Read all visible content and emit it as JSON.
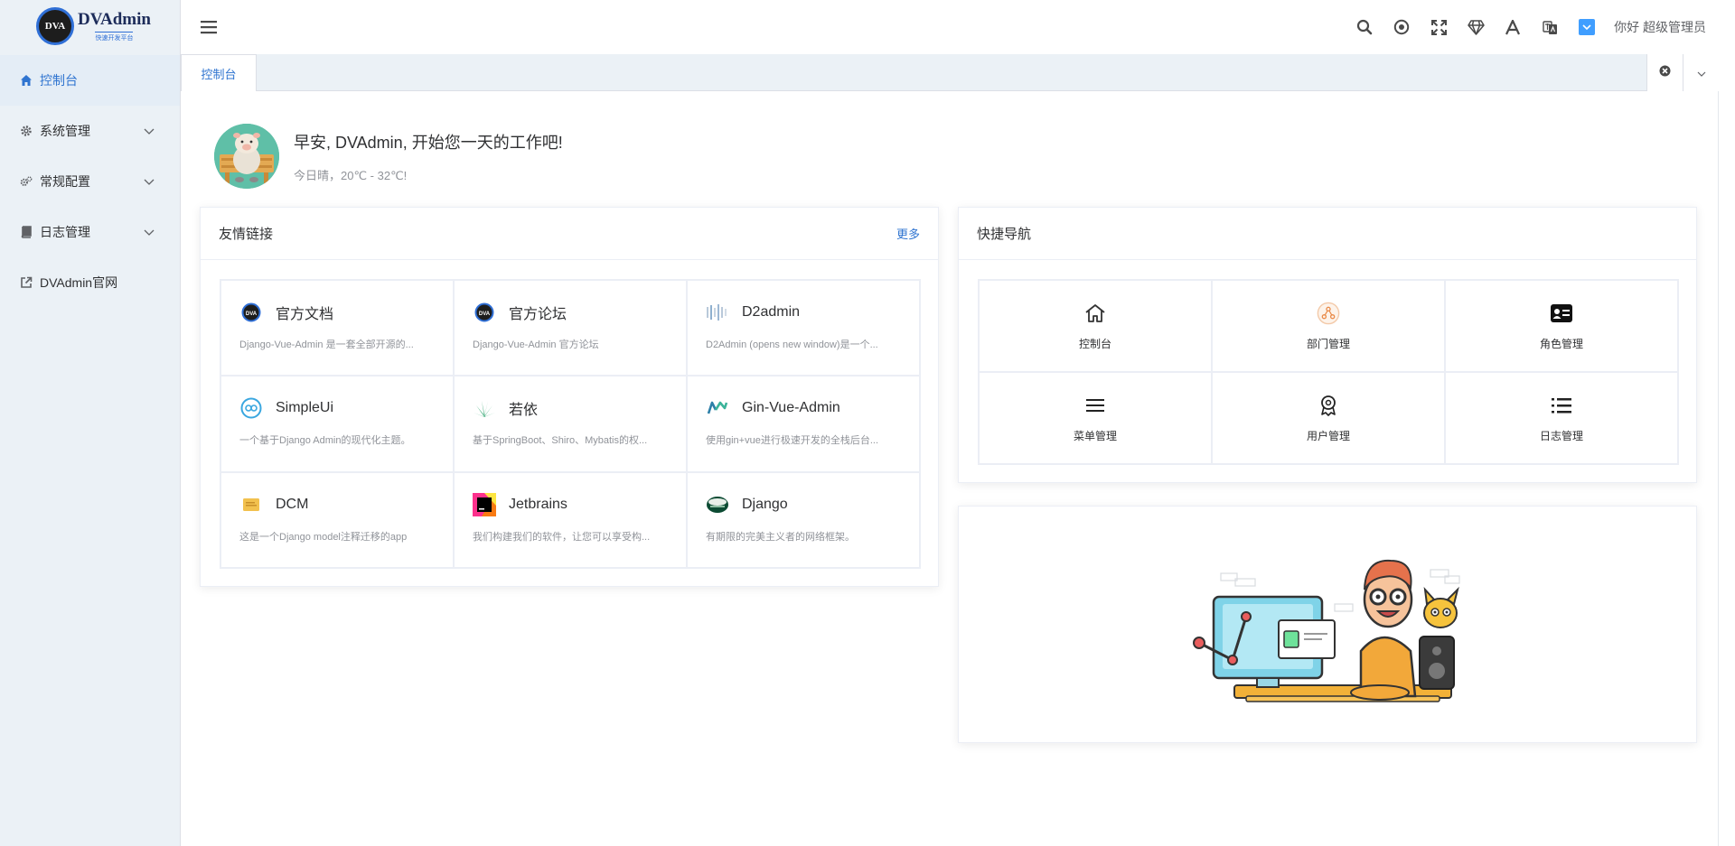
{
  "app": {
    "logo_mark": "DVA",
    "logo_title": "DVAdmin",
    "logo_subtitle": "快速开发平台"
  },
  "sidebar": {
    "items": [
      {
        "label": "控制台",
        "icon": "home-icon",
        "active": true
      },
      {
        "label": "系统管理",
        "icon": "gear-icon",
        "expandable": true
      },
      {
        "label": "常规配置",
        "icon": "gears-icon",
        "expandable": true
      },
      {
        "label": "日志管理",
        "icon": "book-icon",
        "expandable": true
      },
      {
        "label": "DVAdmin官网",
        "icon": "external-link-icon"
      }
    ]
  },
  "header": {
    "user_greeting": "你好 超级管理员",
    "tools": [
      "search-icon",
      "record-icon",
      "fullscreen-icon",
      "diamond-icon",
      "font-size-icon",
      "translate-icon",
      "theme-color-icon"
    ]
  },
  "tabs": {
    "items": [
      {
        "label": "控制台",
        "active": true
      }
    ]
  },
  "welcome": {
    "title": "早安, DVAdmin, 开始您一天的工作吧!",
    "subtitle": "今日晴，20℃ - 32℃!"
  },
  "links_card": {
    "title": "友情链接",
    "more": "更多",
    "items": [
      {
        "name": "官方文档",
        "desc": "Django-Vue-Admin 是一套全部开源的...",
        "icon": "dva-logo"
      },
      {
        "name": "官方论坛",
        "desc": "Django-Vue-Admin 官方论坛",
        "icon": "dva-logo"
      },
      {
        "name": "D2admin",
        "desc": "D2Admin (opens new window)是一个...",
        "icon": "d2admin-logo"
      },
      {
        "name": "SimpleUi",
        "desc": "一个基于Django Admin的现代化主题。",
        "icon": "simpleui-logo"
      },
      {
        "name": "若依",
        "desc": "基于SpringBoot、Shiro、Mybatis的权...",
        "icon": "ruoyi-logo"
      },
      {
        "name": "Gin-Vue-Admin",
        "desc": "使用gin+vue进行极速开发的全栈后台...",
        "icon": "gin-vue-admin-logo"
      },
      {
        "name": "DCM",
        "desc": "这是一个Django model注释迁移的app",
        "icon": "dcm-logo"
      },
      {
        "name": "Jetbrains",
        "desc": "我们构建我们的软件，让您可以享受构...",
        "icon": "jetbrains-logo"
      },
      {
        "name": "Django",
        "desc": "有期限的完美主义者的网络框架。",
        "icon": "django-logo"
      }
    ]
  },
  "nav_card": {
    "title": "快捷导航",
    "items": [
      {
        "label": "控制台",
        "icon": "home-outline-icon"
      },
      {
        "label": "部门管理",
        "icon": "department-icon"
      },
      {
        "label": "角色管理",
        "icon": "id-card-icon"
      },
      {
        "label": "菜单管理",
        "icon": "menu-lines-icon"
      },
      {
        "label": "用户管理",
        "icon": "user-badge-icon"
      },
      {
        "label": "日志管理",
        "icon": "list-icon"
      }
    ]
  },
  "colors": {
    "accent": "#2f74d0",
    "sidebar_bg": "#ebf1f6",
    "text": "#303133",
    "muted": "#909399"
  }
}
